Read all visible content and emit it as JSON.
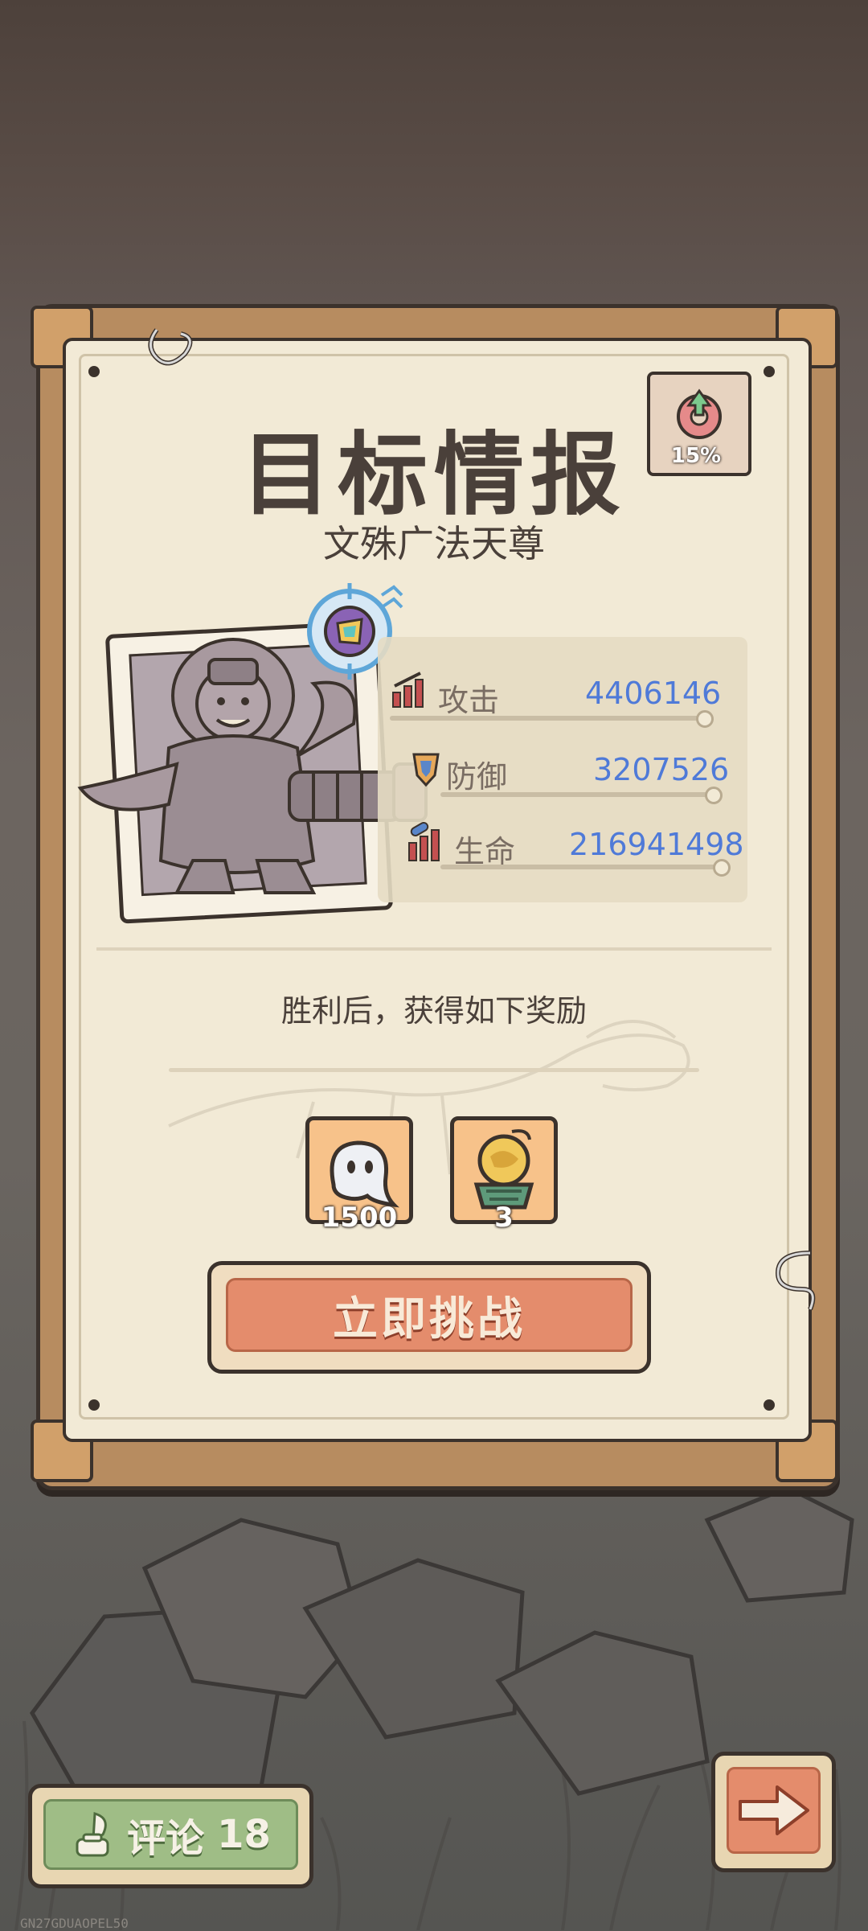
{
  "card": {
    "title": "目标情报",
    "subtitle": "文殊广法天尊",
    "badge_percent": "15%"
  },
  "stats": [
    {
      "icon": "attack-icon",
      "label": "攻击",
      "value": "4406146"
    },
    {
      "icon": "defense-icon",
      "label": "防御",
      "value": "3207526"
    },
    {
      "icon": "health-icon",
      "label": "生命",
      "value": "216941498"
    }
  ],
  "rewards": {
    "heading": "胜利后，获得如下奖励",
    "items": [
      {
        "icon": "ghost-soul-icon",
        "count": "1500"
      },
      {
        "icon": "golden-orb-icon",
        "count": "3"
      }
    ]
  },
  "actions": {
    "challenge_label": "立即挑战",
    "comment_label": "评论",
    "comment_count": "18"
  },
  "device_id": "GN27GDUAOPEL50",
  "colors": {
    "accent_orange": "#e48c6c",
    "accent_green": "#9fbd86",
    "stat_value_blue": "#4f7ad8",
    "paper": "#f2ead6",
    "frame": "#b78c60"
  }
}
